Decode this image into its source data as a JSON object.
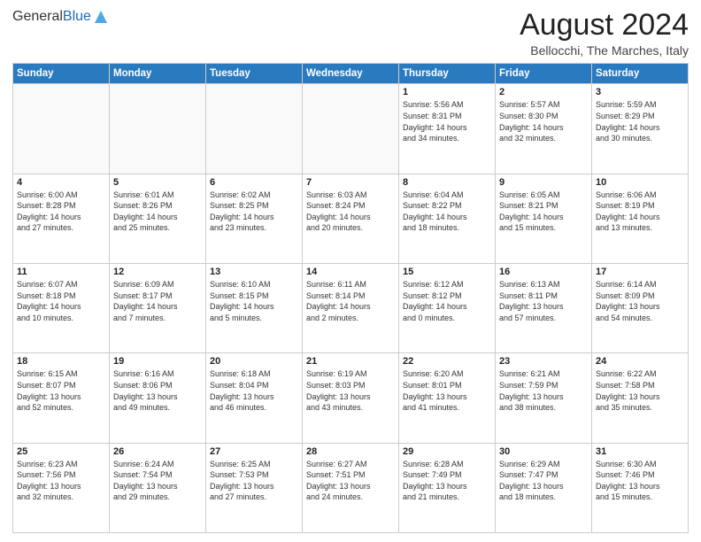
{
  "header": {
    "logo_general": "General",
    "logo_blue": "Blue",
    "month_year": "August 2024",
    "location": "Bellocchi, The Marches, Italy"
  },
  "days_of_week": [
    "Sunday",
    "Monday",
    "Tuesday",
    "Wednesday",
    "Thursday",
    "Friday",
    "Saturday"
  ],
  "weeks": [
    [
      {
        "date": "",
        "info": ""
      },
      {
        "date": "",
        "info": ""
      },
      {
        "date": "",
        "info": ""
      },
      {
        "date": "",
        "info": ""
      },
      {
        "date": "1",
        "info": "Sunrise: 5:56 AM\nSunset: 8:31 PM\nDaylight: 14 hours\nand 34 minutes."
      },
      {
        "date": "2",
        "info": "Sunrise: 5:57 AM\nSunset: 8:30 PM\nDaylight: 14 hours\nand 32 minutes."
      },
      {
        "date": "3",
        "info": "Sunrise: 5:59 AM\nSunset: 8:29 PM\nDaylight: 14 hours\nand 30 minutes."
      }
    ],
    [
      {
        "date": "4",
        "info": "Sunrise: 6:00 AM\nSunset: 8:28 PM\nDaylight: 14 hours\nand 27 minutes."
      },
      {
        "date": "5",
        "info": "Sunrise: 6:01 AM\nSunset: 8:26 PM\nDaylight: 14 hours\nand 25 minutes."
      },
      {
        "date": "6",
        "info": "Sunrise: 6:02 AM\nSunset: 8:25 PM\nDaylight: 14 hours\nand 23 minutes."
      },
      {
        "date": "7",
        "info": "Sunrise: 6:03 AM\nSunset: 8:24 PM\nDaylight: 14 hours\nand 20 minutes."
      },
      {
        "date": "8",
        "info": "Sunrise: 6:04 AM\nSunset: 8:22 PM\nDaylight: 14 hours\nand 18 minutes."
      },
      {
        "date": "9",
        "info": "Sunrise: 6:05 AM\nSunset: 8:21 PM\nDaylight: 14 hours\nand 15 minutes."
      },
      {
        "date": "10",
        "info": "Sunrise: 6:06 AM\nSunset: 8:19 PM\nDaylight: 14 hours\nand 13 minutes."
      }
    ],
    [
      {
        "date": "11",
        "info": "Sunrise: 6:07 AM\nSunset: 8:18 PM\nDaylight: 14 hours\nand 10 minutes."
      },
      {
        "date": "12",
        "info": "Sunrise: 6:09 AM\nSunset: 8:17 PM\nDaylight: 14 hours\nand 7 minutes."
      },
      {
        "date": "13",
        "info": "Sunrise: 6:10 AM\nSunset: 8:15 PM\nDaylight: 14 hours\nand 5 minutes."
      },
      {
        "date": "14",
        "info": "Sunrise: 6:11 AM\nSunset: 8:14 PM\nDaylight: 14 hours\nand 2 minutes."
      },
      {
        "date": "15",
        "info": "Sunrise: 6:12 AM\nSunset: 8:12 PM\nDaylight: 14 hours\nand 0 minutes."
      },
      {
        "date": "16",
        "info": "Sunrise: 6:13 AM\nSunset: 8:11 PM\nDaylight: 13 hours\nand 57 minutes."
      },
      {
        "date": "17",
        "info": "Sunrise: 6:14 AM\nSunset: 8:09 PM\nDaylight: 13 hours\nand 54 minutes."
      }
    ],
    [
      {
        "date": "18",
        "info": "Sunrise: 6:15 AM\nSunset: 8:07 PM\nDaylight: 13 hours\nand 52 minutes."
      },
      {
        "date": "19",
        "info": "Sunrise: 6:16 AM\nSunset: 8:06 PM\nDaylight: 13 hours\nand 49 minutes."
      },
      {
        "date": "20",
        "info": "Sunrise: 6:18 AM\nSunset: 8:04 PM\nDaylight: 13 hours\nand 46 minutes."
      },
      {
        "date": "21",
        "info": "Sunrise: 6:19 AM\nSunset: 8:03 PM\nDaylight: 13 hours\nand 43 minutes."
      },
      {
        "date": "22",
        "info": "Sunrise: 6:20 AM\nSunset: 8:01 PM\nDaylight: 13 hours\nand 41 minutes."
      },
      {
        "date": "23",
        "info": "Sunrise: 6:21 AM\nSunset: 7:59 PM\nDaylight: 13 hours\nand 38 minutes."
      },
      {
        "date": "24",
        "info": "Sunrise: 6:22 AM\nSunset: 7:58 PM\nDaylight: 13 hours\nand 35 minutes."
      }
    ],
    [
      {
        "date": "25",
        "info": "Sunrise: 6:23 AM\nSunset: 7:56 PM\nDaylight: 13 hours\nand 32 minutes."
      },
      {
        "date": "26",
        "info": "Sunrise: 6:24 AM\nSunset: 7:54 PM\nDaylight: 13 hours\nand 29 minutes."
      },
      {
        "date": "27",
        "info": "Sunrise: 6:25 AM\nSunset: 7:53 PM\nDaylight: 13 hours\nand 27 minutes."
      },
      {
        "date": "28",
        "info": "Sunrise: 6:27 AM\nSunset: 7:51 PM\nDaylight: 13 hours\nand 24 minutes."
      },
      {
        "date": "29",
        "info": "Sunrise: 6:28 AM\nSunset: 7:49 PM\nDaylight: 13 hours\nand 21 minutes."
      },
      {
        "date": "30",
        "info": "Sunrise: 6:29 AM\nSunset: 7:47 PM\nDaylight: 13 hours\nand 18 minutes."
      },
      {
        "date": "31",
        "info": "Sunrise: 6:30 AM\nSunset: 7:46 PM\nDaylight: 13 hours\nand 15 minutes."
      }
    ]
  ]
}
